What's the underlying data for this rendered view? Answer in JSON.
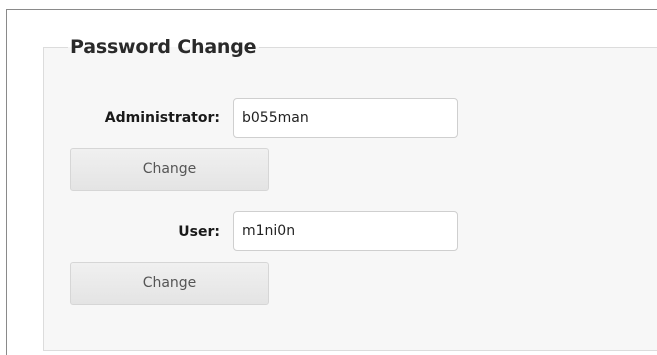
{
  "section": {
    "title": "Password Change"
  },
  "administrator": {
    "label": "Administrator:",
    "value": "b055man",
    "button_label": "Change"
  },
  "user": {
    "label": "User:",
    "value": "m1ni0n",
    "button_label": "Change"
  }
}
